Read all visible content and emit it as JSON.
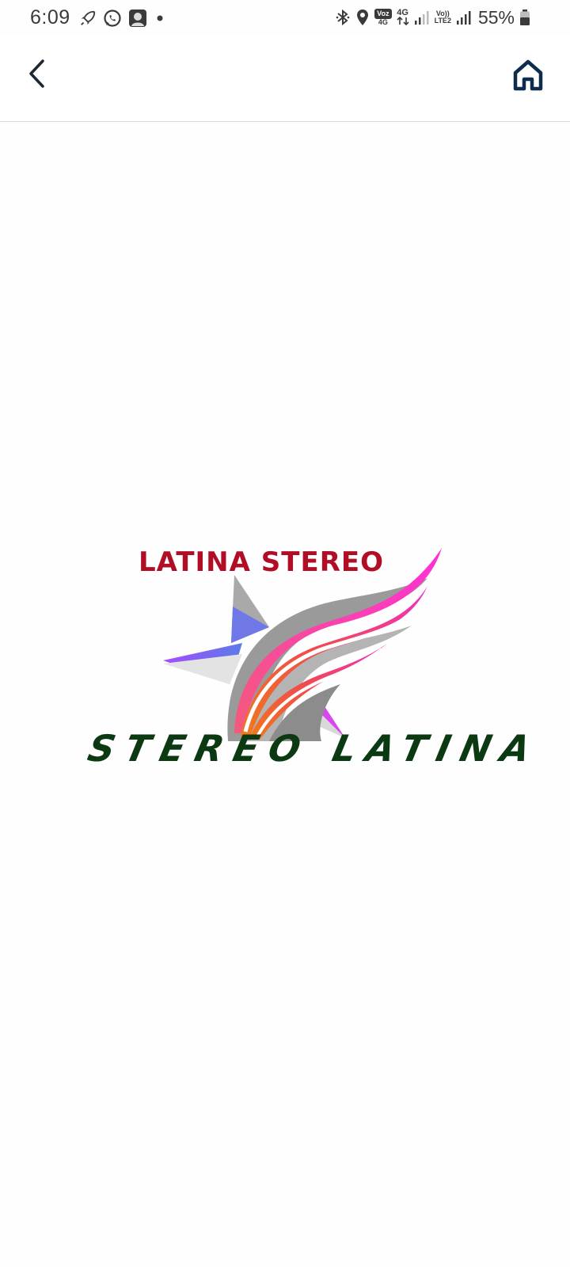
{
  "status_bar": {
    "time": "6:09",
    "battery_percent": "55%",
    "volte_label": "Vo))",
    "lte2_label": "LTE2",
    "voz_label": "Voz",
    "g4_label": "4G",
    "icons": [
      "rocket-icon",
      "whatsapp-icon",
      "contact-photo-icon",
      "dot-icon",
      "bluetooth-icon",
      "location-icon",
      "signal-icon",
      "battery-icon"
    ]
  },
  "toolbar": {
    "back_icon": "chevron-left-icon",
    "home_icon": "home-icon",
    "accent_color": "#0d2d4f"
  },
  "logo": {
    "top_text": "LATINA STEREO",
    "bottom_text": "STEREO LATINA",
    "top_color": "#b10e26",
    "bottom_color": "#0b3a12"
  }
}
